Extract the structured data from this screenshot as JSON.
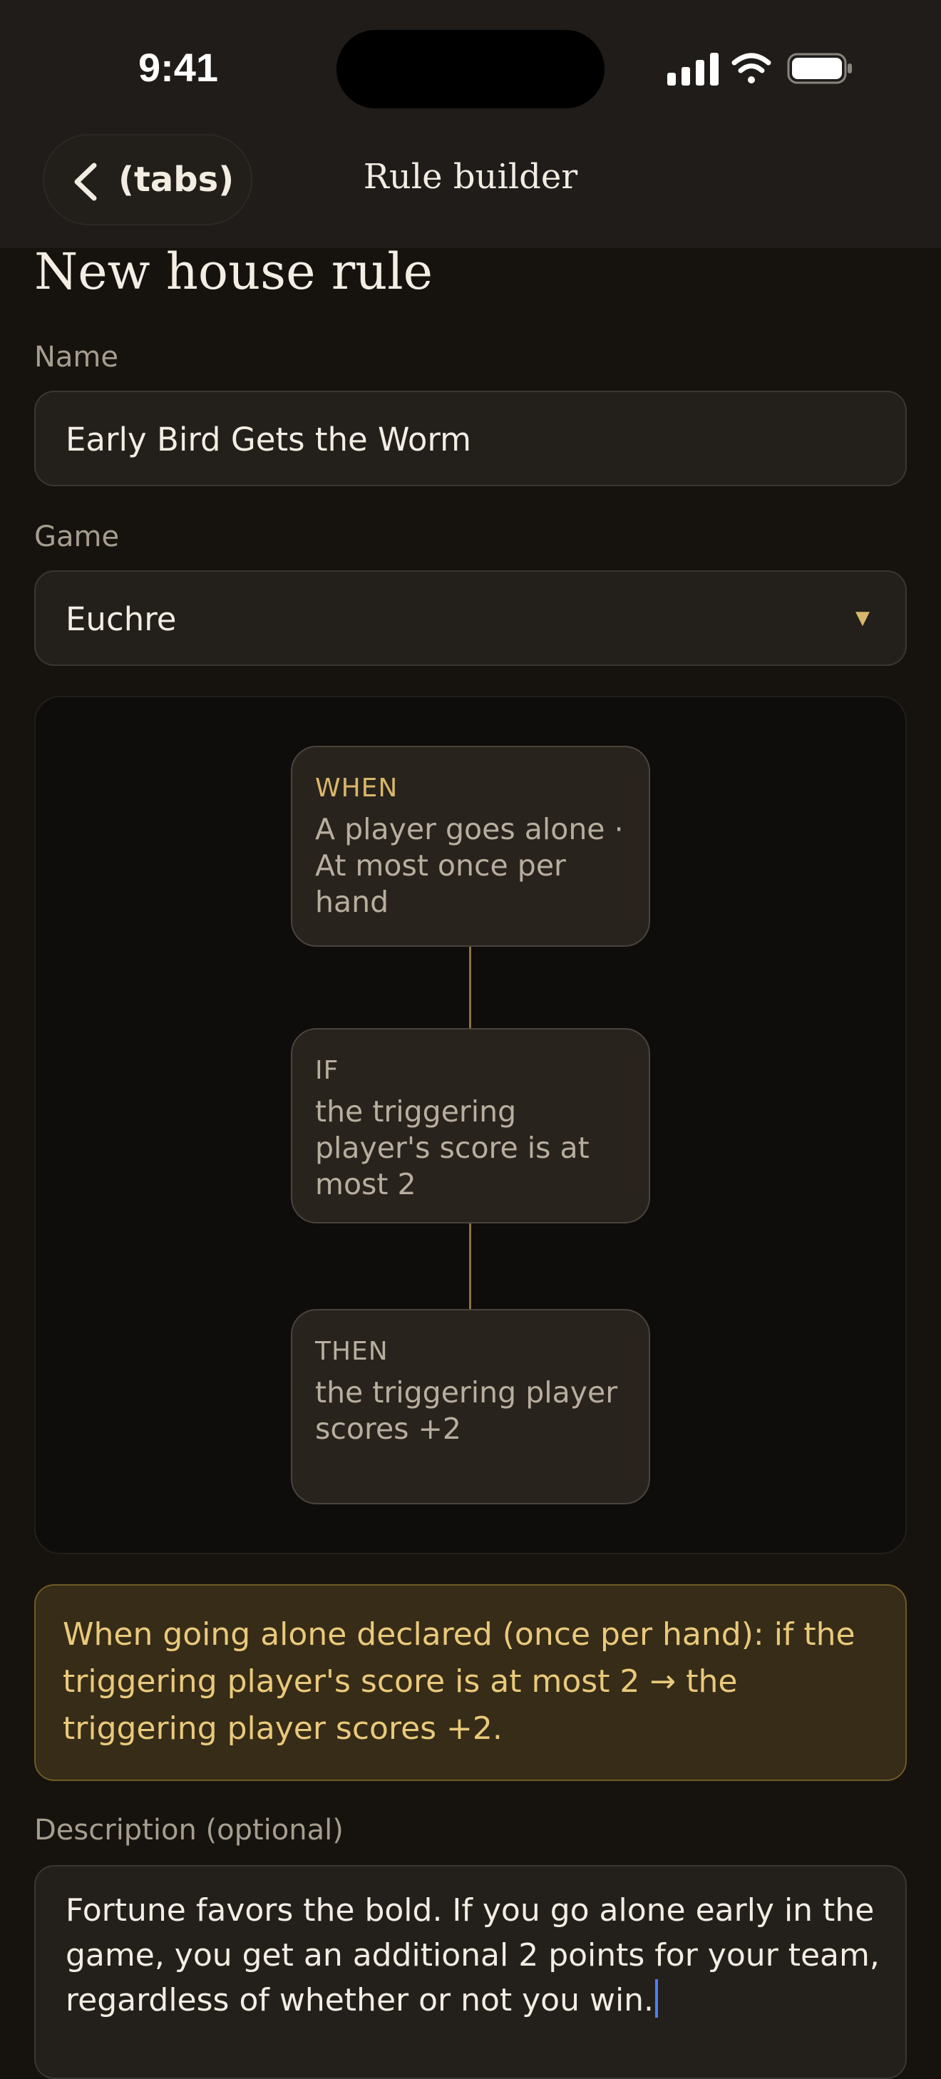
{
  "status_bar": {
    "time": "9:41",
    "icons": [
      "cellular-signal-icon",
      "wifi-icon",
      "battery-icon"
    ]
  },
  "nav": {
    "back_label": "(tabs)",
    "title": "Rule builder"
  },
  "page": {
    "title": "New house rule"
  },
  "form": {
    "name_label": "Name",
    "name_value": "Early Bird Gets the Worm",
    "game_label": "Game",
    "game_value": "Euchre",
    "description_label": "Description (optional)",
    "description_value": "Fortune favors the bold. If you go alone early in the game, you get an additional 2 points for your team, regardless of whether or not you win."
  },
  "flow": {
    "nodes": [
      {
        "kind": "WHEN",
        "text": "A player goes alone · At most once per hand"
      },
      {
        "kind": "IF",
        "text": "the triggering player's score is at most 2"
      },
      {
        "kind": "THEN",
        "text": "the triggering player scores +2"
      }
    ]
  },
  "summary": "When going alone declared (once per hand): if the triggering player's score is at most 2 → the triggering player scores +2.",
  "colors": {
    "background": "#16130f",
    "accent_gold": "#d9b76a",
    "summary_bg": "#362c17",
    "text_caret": "#4f7cff"
  }
}
